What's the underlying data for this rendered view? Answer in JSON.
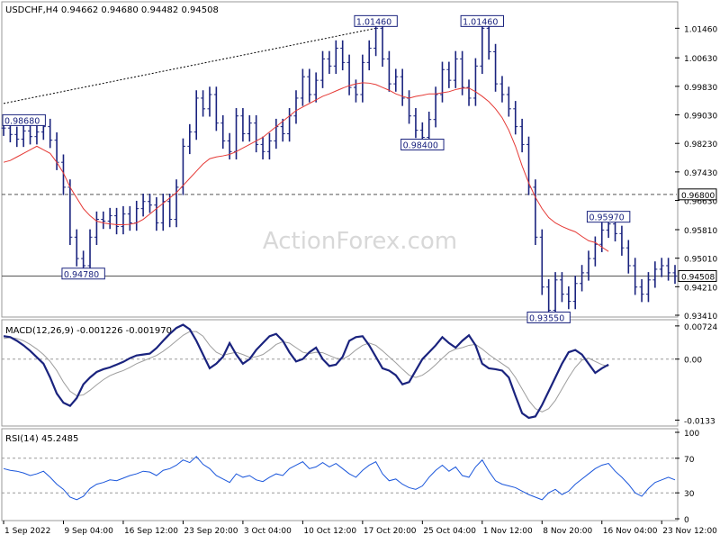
{
  "chart_data": {
    "type": "line",
    "symbol": "USDCHF,H4",
    "ohlc_header": "USDCHF,H4  0.94662 0.94680 0.94482 0.94508",
    "watermark": "ActionForex.com",
    "colors": {
      "price": "#1a237e",
      "ma": "#e53935",
      "signal": "#9e9e9e",
      "trendline": "#000000",
      "level_line": "#555555"
    },
    "x_axis": {
      "tick_labels": [
        "1 Sep 2022",
        "9 Sep 04:00",
        "16 Sep 12:00",
        "23 Sep 20:00",
        "3 Oct 04:00",
        "10 Oct 12:00",
        "17 Oct 20:00",
        "25 Oct 04:00",
        "1 Nov 12:00",
        "8 Nov 20:00",
        "16 Nov 04:00",
        "23 Nov 12:00"
      ],
      "tick_index": [
        0,
        9,
        18,
        27,
        36,
        45,
        54,
        63,
        72,
        81,
        90,
        99
      ]
    },
    "price_panel": {
      "ylim": [
        0.9341,
        1.0205
      ],
      "ticks": [
        "1.01460",
        "1.00630",
        "0.99830",
        "0.99030",
        "0.98230",
        "0.97430",
        "0.96630",
        "0.95810",
        "0.95010",
        "0.94210",
        "0.93410"
      ],
      "series_close": [
        0.9866,
        0.9848,
        0.9835,
        0.9858,
        0.9842,
        0.9855,
        0.987,
        0.9832,
        0.977,
        0.97,
        0.956,
        0.95,
        0.948,
        0.956,
        0.961,
        0.9605,
        0.962,
        0.959,
        0.9625,
        0.96,
        0.964,
        0.966,
        0.965,
        0.96,
        0.966,
        0.961,
        0.97,
        0.9815,
        0.9855,
        0.995,
        0.992,
        0.996,
        0.988,
        0.983,
        0.98,
        0.99,
        0.985,
        0.988,
        0.982,
        0.98,
        0.983,
        0.987,
        0.985,
        0.99,
        0.995,
        1.001,
        0.996,
        1.0,
        1.006,
        1.004,
        1.009,
        1.005,
        0.998,
        0.996,
        1.005,
        1.009,
        1.0146,
        1.006,
        0.999,
        1.001,
        0.995,
        0.99,
        0.986,
        0.984,
        0.989,
        0.996,
        1.003,
        1.0,
        1.006,
        0.998,
        0.995,
        1.004,
        1.0146,
        1.008,
        0.999,
        0.996,
        0.992,
        0.987,
        0.982,
        0.97,
        0.956,
        0.942,
        0.9355,
        0.944,
        0.94,
        0.938,
        0.943,
        0.946,
        0.95,
        0.954,
        0.958,
        0.9597,
        0.957,
        0.953,
        0.948,
        0.942,
        0.94,
        0.944,
        0.947,
        0.948,
        0.946,
        0.9451
      ],
      "ma_series": [
        0.977,
        0.9775,
        0.9785,
        0.9795,
        0.9805,
        0.9815,
        0.9805,
        0.9795,
        0.977,
        0.974,
        0.97,
        0.967,
        0.964,
        0.962,
        0.9605,
        0.96,
        0.9597,
        0.9595,
        0.9595,
        0.9596,
        0.96,
        0.961,
        0.9625,
        0.964,
        0.9655,
        0.967,
        0.9685,
        0.9705,
        0.9725,
        0.9745,
        0.9765,
        0.978,
        0.9785,
        0.9788,
        0.9792,
        0.98,
        0.981,
        0.982,
        0.983,
        0.984,
        0.9855,
        0.987,
        0.9885,
        0.99,
        0.9915,
        0.9925,
        0.9935,
        0.9945,
        0.9955,
        0.9962,
        0.997,
        0.9978,
        0.9985,
        0.999,
        0.9993,
        0.9992,
        0.9988,
        0.998,
        0.9972,
        0.9962,
        0.9955,
        0.995,
        0.9955,
        0.9958,
        0.9962,
        0.9962,
        0.9965,
        0.9968,
        0.9974,
        0.9978,
        0.9978,
        0.9968,
        0.9955,
        0.994,
        0.992,
        0.9895,
        0.986,
        0.9815,
        0.976,
        0.9712,
        0.9672,
        0.964,
        0.9615,
        0.96,
        0.959,
        0.9582,
        0.9575,
        0.9562,
        0.955,
        0.9545,
        0.9532,
        0.952
      ],
      "ma_start_index": 0,
      "hlines": [
        {
          "value": 0.968,
          "label": "0.96800",
          "style": "dashed"
        },
        {
          "value": 0.9451,
          "label": "0.94508",
          "style": "solid"
        }
      ],
      "trendline": {
        "from": [
          0,
          0.9935
        ],
        "to": [
          56,
          1.0146
        ]
      },
      "annotations": [
        {
          "label": "0.98680",
          "index": 0,
          "value": 0.9868
        },
        {
          "label": "0.94780",
          "index": 12,
          "value": 0.9478
        },
        {
          "label": "1.01460",
          "index": 56,
          "value": 1.0146
        },
        {
          "label": "1.01460",
          "index": 72,
          "value": 1.0146
        },
        {
          "label": "0.98400",
          "index": 63,
          "value": 0.984
        },
        {
          "label": "0.95970",
          "index": 91,
          "value": 0.9597
        },
        {
          "label": "0.93550",
          "index": 82,
          "value": 0.9355
        }
      ]
    },
    "macd_panel": {
      "label": "MACD(12,26,9) -0.001226 -0.001970",
      "ylim": [
        -0.014,
        0.008
      ],
      "ticks": [
        "0.00724",
        "0.00",
        "-0.0133"
      ],
      "macd": [
        0.005,
        0.0048,
        0.004,
        0.003,
        0.0018,
        0.0004,
        -0.001,
        -0.004,
        -0.0075,
        -0.0095,
        -0.0102,
        -0.0085,
        -0.0055,
        -0.004,
        -0.0028,
        -0.0022,
        -0.0018,
        -0.0012,
        -0.0006,
        0.0002,
        0.0008,
        0.001,
        0.0012,
        0.0024,
        0.004,
        0.0055,
        0.0068,
        0.0075,
        0.0065,
        0.004,
        0.001,
        -0.002,
        -0.001,
        0.0005,
        0.0035,
        0.001,
        -0.001,
        0.0,
        0.002,
        0.0035,
        0.005,
        0.0055,
        0.004,
        0.0015,
        -0.0005,
        0.0,
        0.0015,
        0.0025,
        0.0,
        -0.0015,
        -0.0012,
        0.0005,
        0.004,
        0.0048,
        0.005,
        0.003,
        0.0005,
        -0.002,
        -0.0025,
        -0.0035,
        -0.0055,
        -0.005,
        -0.0025,
        0.0,
        0.0015,
        0.003,
        0.0048,
        0.0035,
        0.0025,
        0.004,
        0.0052,
        0.003,
        -0.001,
        -0.002,
        -0.0022,
        -0.0025,
        -0.004,
        -0.008,
        -0.0118,
        -0.0128,
        -0.0125,
        -0.01,
        -0.007,
        -0.004,
        -0.001,
        0.0015,
        0.002,
        0.001,
        -0.001,
        -0.003,
        -0.002,
        -0.0012
      ],
      "signal": [
        0.0045,
        0.0047,
        0.0045,
        0.004,
        0.0032,
        0.0022,
        0.001,
        -0.0005,
        -0.0025,
        -0.005,
        -0.007,
        -0.008,
        -0.0078,
        -0.0068,
        -0.0056,
        -0.0045,
        -0.0036,
        -0.003,
        -0.0025,
        -0.0018,
        -0.001,
        -0.0004,
        0.0002,
        0.0008,
        0.0017,
        0.0028,
        0.004,
        0.0052,
        0.006,
        0.006,
        0.005,
        0.003,
        0.0015,
        0.0008,
        0.0012,
        0.0015,
        0.001,
        0.0004,
        0.0005,
        0.001,
        0.002,
        0.0032,
        0.0038,
        0.0035,
        0.0025,
        0.0015,
        0.0012,
        0.0015,
        0.0014,
        0.0008,
        0.0002,
        0.0,
        0.0008,
        0.002,
        0.003,
        0.0035,
        0.003,
        0.0018,
        0.0005,
        -0.0008,
        -0.0022,
        -0.0035,
        -0.004,
        -0.0035,
        -0.0025,
        -0.0012,
        0.0002,
        0.0015,
        0.0022,
        0.0025,
        0.003,
        0.0032,
        0.0022,
        0.001,
        0.0,
        -0.001,
        -0.002,
        -0.004,
        -0.0065,
        -0.009,
        -0.0108,
        -0.0115,
        -0.0108,
        -0.009,
        -0.0065,
        -0.004,
        -0.0018,
        -0.0002,
        0.0002,
        -0.0005,
        -0.0012,
        -0.0016
      ]
    },
    "rsi_panel": {
      "label": "RSI(14) 45.2485",
      "ylim": [
        0,
        100
      ],
      "ticks": [
        100,
        70,
        30,
        0
      ],
      "levels": [
        70,
        30
      ],
      "rsi": [
        58,
        56,
        55,
        53,
        50,
        52,
        55,
        48,
        40,
        34,
        25,
        22,
        26,
        35,
        40,
        42,
        45,
        44,
        47,
        50,
        52,
        55,
        54,
        50,
        56,
        58,
        62,
        68,
        65,
        72,
        63,
        58,
        50,
        46,
        42,
        52,
        48,
        50,
        45,
        43,
        48,
        52,
        50,
        58,
        62,
        66,
        58,
        60,
        65,
        60,
        64,
        58,
        52,
        48,
        56,
        62,
        66,
        52,
        44,
        46,
        40,
        36,
        34,
        38,
        48,
        56,
        62,
        55,
        60,
        50,
        48,
        60,
        68,
        55,
        44,
        40,
        38,
        36,
        32,
        28,
        25,
        22,
        30,
        34,
        28,
        32,
        40,
        46,
        52,
        58,
        62,
        64,
        55,
        48,
        40,
        30,
        26,
        35,
        42,
        45,
        48,
        45
      ]
    }
  }
}
